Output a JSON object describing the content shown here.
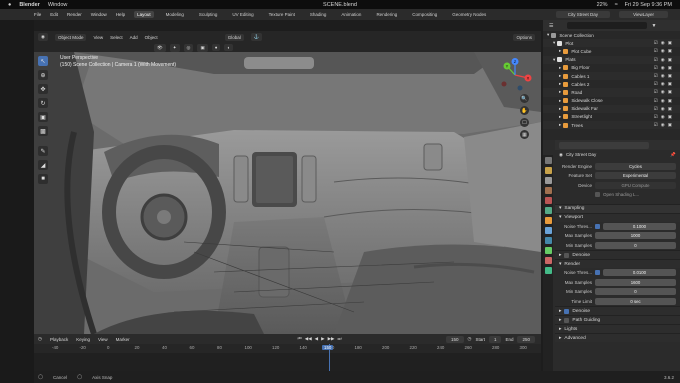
{
  "mac_menubar": {
    "app": "Blender",
    "menu": "Window",
    "title": "SCENE.blend",
    "battery": "22%",
    "datetime": "Fri 29 Sep 9:36 PM"
  },
  "topbar": {
    "menus": [
      "File",
      "Edit",
      "Render",
      "Window",
      "Help"
    ],
    "workspaces": [
      "Layout",
      "Modeling",
      "Sculpting",
      "UV Editing",
      "Texture Paint",
      "Shading",
      "Animation",
      "Rendering",
      "Compositing",
      "Geometry Nodes"
    ],
    "active_workspace": "Layout",
    "scene": "City Street Day",
    "view_layer": "ViewLayer"
  },
  "viewport_header": {
    "mode": "Object Mode",
    "menus": [
      "View",
      "Select",
      "Add",
      "Object"
    ],
    "transform": "Global",
    "options": "Options"
  },
  "viewport_info": {
    "line1": "User Perspective",
    "line2": "(150) Scene Collection | Camera 1 (With Movement)"
  },
  "gizmo": {
    "x": "X",
    "y": "Y",
    "z": "Z"
  },
  "outliner": {
    "rows": [
      {
        "label": "Scene Collection",
        "indent": 0,
        "color": "#9a9a9a"
      },
      {
        "label": "Plot",
        "indent": 1,
        "color": "#e0e0e0"
      },
      {
        "label": "Plot Cube",
        "indent": 2,
        "color": "#e89b3c"
      },
      {
        "label": "Plats",
        "indent": 1,
        "color": "#e0e0e0"
      },
      {
        "label": "Big Floor",
        "indent": 2,
        "color": "#e89b3c"
      },
      {
        "label": "Cables 1",
        "indent": 2,
        "color": "#e89b3c"
      },
      {
        "label": "Cables 2",
        "indent": 2,
        "color": "#e89b3c"
      },
      {
        "label": "Road",
        "indent": 2,
        "color": "#e89b3c"
      },
      {
        "label": "Sidewalk Close",
        "indent": 2,
        "color": "#e89b3c"
      },
      {
        "label": "Sidewalk Far",
        "indent": 2,
        "color": "#e89b3c"
      },
      {
        "label": "Streetlight",
        "indent": 2,
        "color": "#e89b3c"
      },
      {
        "label": "Trees",
        "indent": 2,
        "color": "#e89b3c"
      }
    ]
  },
  "properties": {
    "scene_name": "City Street Day",
    "render_engine_label": "Render Engine",
    "render_engine": "Cycles",
    "feature_set_label": "Feature Set",
    "feature_set": "Experimental",
    "device_label": "Device",
    "device": "GPU Compute",
    "osl": "Open Shading L...",
    "sampling": "Sampling",
    "viewport": "Viewport",
    "noise_label": "Noise Thres...",
    "noise_value": "0.1000",
    "max_samples_label": "Max Samples",
    "max_samples": "1000",
    "min_samples_label": "Min Samples",
    "min_samples": "0",
    "denoise": "Denoise",
    "render": "Render",
    "r_noise_label": "Noise Thres...",
    "r_noise_value": "0.0100",
    "r_max_label": "Max Samples",
    "r_max": "1600",
    "r_min_label": "Min Samples",
    "r_min": "0",
    "time_limit_label": "Time Limit",
    "time_limit": "0 sec",
    "r_denoise": "Denoise",
    "path_guiding": "Path Guiding",
    "lights": "Lights",
    "advanced": "Advanced"
  },
  "timeline": {
    "menus": [
      "Playback",
      "Keying",
      "View",
      "Marker"
    ],
    "current_frame": "150",
    "start_label": "Start",
    "start": "1",
    "end_label": "End",
    "end": "250",
    "ruler": [
      "-40",
      "-20",
      "0",
      "20",
      "40",
      "60",
      "80",
      "100",
      "120",
      "140",
      "150",
      "180",
      "200",
      "220",
      "240",
      "260",
      "280",
      "300"
    ]
  },
  "status": {
    "items": [
      "Cancel",
      "Axis Snap"
    ],
    "version": "3.6.2"
  }
}
